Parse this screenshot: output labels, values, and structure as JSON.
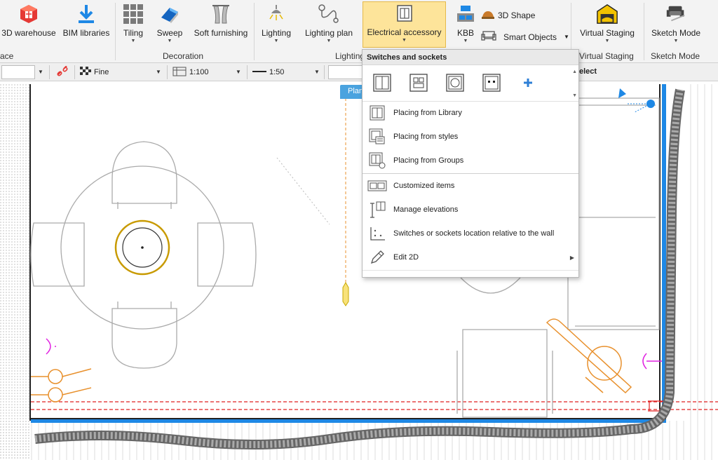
{
  "ribbon": {
    "buttons": [
      {
        "label": "3D warehouse",
        "icon": "3d-warehouse-icon"
      },
      {
        "label": "BIM libraries",
        "icon": "download-icon"
      },
      {
        "label": "Tiling",
        "icon": "tiling-icon"
      },
      {
        "label": "Sweep",
        "icon": "sweep-icon"
      },
      {
        "label": "Soft furnishing",
        "icon": "curtain-icon"
      },
      {
        "label": "Lighting",
        "icon": "ceiling-lamp-icon"
      },
      {
        "label": "Lighting plan",
        "icon": "lighting-plan-icon"
      },
      {
        "label": "Electrical accessory",
        "icon": "switch-icon"
      },
      {
        "label": "KBB",
        "icon": "kbb-icon"
      },
      {
        "label": "Virtual Staging",
        "icon": "garage-icon"
      },
      {
        "label": "Sketch Mode",
        "icon": "sketch-icon"
      }
    ],
    "small_buttons": [
      {
        "label": "3D Shape",
        "icon": "3d-shape-icon"
      },
      {
        "label": "Smart Objects",
        "icon": "sofa-icon"
      }
    ],
    "groups": [
      "ace",
      "Decoration",
      "Lighting",
      "Virtual Staging",
      "Sketch Mode"
    ]
  },
  "toolbar": {
    "fill_label": "Fine",
    "scale1": "1:100",
    "scale2": "1:50",
    "select_label": "elect"
  },
  "canvas": {
    "plan_tab": "Plan"
  },
  "dropdown": {
    "header": "Switches and sockets",
    "icons": [
      "single-switch-icon",
      "double-socket-icon",
      "round-socket-icon",
      "dual-point-socket-icon",
      "add-icon"
    ],
    "items": [
      {
        "label": "Placing from Library",
        "icon": "library-icon"
      },
      {
        "label": "Placing from styles",
        "icon": "styles-icon"
      },
      {
        "label": "Placing from Groups",
        "icon": "groups-icon"
      },
      {
        "label": "Customized items",
        "icon": "customized-icon"
      },
      {
        "label": "Manage elevations",
        "icon": "elevation-icon"
      },
      {
        "label": "Switches or sockets location relative to the wall",
        "icon": "wall-location-icon"
      },
      {
        "label": "Edit 2D",
        "icon": "pencil-icon"
      }
    ]
  },
  "colors": {
    "accent": "#fde49a",
    "wall_blue": "#1e88e5",
    "orange": "#e8902c",
    "magenta": "#e020e0",
    "red_dash": "#e02020"
  }
}
